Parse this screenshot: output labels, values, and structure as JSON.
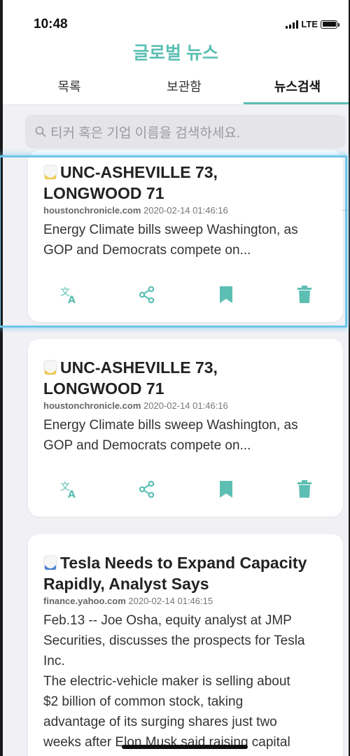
{
  "status_bar": {
    "time": "10:48",
    "network": "LTE"
  },
  "app": {
    "title": "글로벌 뉴스"
  },
  "tabs": [
    {
      "label": "목록",
      "active": false
    },
    {
      "label": "보관함",
      "active": false
    },
    {
      "label": "뉴스검색",
      "active": true
    }
  ],
  "search": {
    "placeholder": "티커 혹은 기업 이름을 검색하세요."
  },
  "colors": {
    "accent": "#5dbfb3",
    "highlight": "#6ec6ea",
    "icon_yellow": "#f2c94c",
    "icon_blue": "#4a7bd0"
  },
  "articles": [
    {
      "title_line1": "UNC-ASHEVILLE 73,",
      "title_line2": "LONGWOOD 71",
      "source": "houstonchronicle.com",
      "date": "2020-02-14 01:46:16",
      "summary_line1": "Energy Climate bills sweep Washington, as",
      "summary_line2": "GOP and Democrats compete on...",
      "icon": "document-icon-yellow"
    },
    {
      "title_line1": "UNC-ASHEVILLE 73,",
      "title_line2": "LONGWOOD 71",
      "source": "houstonchronicle.com",
      "date": "2020-02-14 01:46:16",
      "summary_line1": "Energy Climate bills sweep Washington, as",
      "summary_line2": "GOP and Democrats compete on...",
      "icon": "document-icon-yellow"
    },
    {
      "title_line1": "Tesla Needs to Expand Capacity",
      "title_line2": "Rapidly, Analyst Says",
      "source": "finance.yahoo.com",
      "date": "2020-02-14 01:46:15",
      "summary_lines": [
        "Feb.13 -- Joe Osha, equity analyst at JMP",
        "Securities, discusses the prospects for Tesla",
        "Inc.",
        "The electric-vehicle maker is selling about",
        "$2 billion of common stock, taking",
        "advantage of its surging shares just two",
        "weeks after Elon Musk said raising capital"
      ],
      "icon": "document-icon-blue"
    }
  ],
  "actions": [
    "translate-icon",
    "share-icon",
    "bookmark-icon",
    "delete-icon"
  ]
}
